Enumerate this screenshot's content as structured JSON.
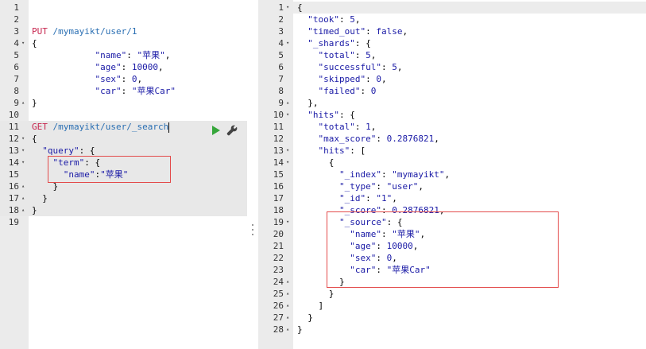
{
  "left_editor": {
    "lines": [
      {
        "n": "1",
        "fold": "",
        "segments": []
      },
      {
        "n": "2",
        "fold": "",
        "segments": []
      },
      {
        "n": "3",
        "fold": "",
        "segments": [
          {
            "t": "PUT",
            "c": "kw"
          },
          {
            "t": " ",
            "c": "punc"
          },
          {
            "t": "/mymayikt/user/1",
            "c": "url"
          }
        ]
      },
      {
        "n": "4",
        "fold": "▾",
        "segments": [
          {
            "t": "{",
            "c": "punc"
          }
        ]
      },
      {
        "n": "5",
        "fold": "",
        "indent": "            ",
        "segments": [
          {
            "t": "\"name\"",
            "c": "key"
          },
          {
            "t": ": ",
            "c": "punc"
          },
          {
            "t": "\"苹果\"",
            "c": "str"
          },
          {
            "t": ",",
            "c": "punc"
          }
        ]
      },
      {
        "n": "6",
        "fold": "",
        "indent": "            ",
        "segments": [
          {
            "t": "\"age\"",
            "c": "key"
          },
          {
            "t": ": ",
            "c": "punc"
          },
          {
            "t": "10000",
            "c": "num"
          },
          {
            "t": ",",
            "c": "punc"
          }
        ]
      },
      {
        "n": "7",
        "fold": "",
        "indent": "            ",
        "segments": [
          {
            "t": "\"sex\"",
            "c": "key"
          },
          {
            "t": ": ",
            "c": "punc"
          },
          {
            "t": "0",
            "c": "num"
          },
          {
            "t": ",",
            "c": "punc"
          }
        ]
      },
      {
        "n": "8",
        "fold": "",
        "indent": "            ",
        "segments": [
          {
            "t": "\"car\"",
            "c": "key"
          },
          {
            "t": ": ",
            "c": "punc"
          },
          {
            "t": "\"苹果Car\"",
            "c": "str"
          }
        ]
      },
      {
        "n": "9",
        "fold": "▴",
        "segments": [
          {
            "t": "}",
            "c": "punc"
          }
        ]
      },
      {
        "n": "10",
        "fold": "",
        "segments": []
      },
      {
        "n": "11",
        "fold": "",
        "segments": [
          {
            "t": "GET",
            "c": "kw"
          },
          {
            "t": " ",
            "c": "punc"
          },
          {
            "t": "/mymayikt/user/_search",
            "c": "url"
          }
        ]
      },
      {
        "n": "12",
        "fold": "▾",
        "segments": [
          {
            "t": "{",
            "c": "punc"
          }
        ]
      },
      {
        "n": "13",
        "fold": "▾",
        "indent": "  ",
        "segments": [
          {
            "t": "\"query\"",
            "c": "key"
          },
          {
            "t": ": {",
            "c": "punc"
          }
        ]
      },
      {
        "n": "14",
        "fold": "▾",
        "indent": "    ",
        "segments": [
          {
            "t": "\"term\"",
            "c": "key"
          },
          {
            "t": ": {",
            "c": "punc"
          }
        ]
      },
      {
        "n": "15",
        "fold": "",
        "indent": "      ",
        "segments": [
          {
            "t": "\"name\"",
            "c": "key"
          },
          {
            "t": ":",
            "c": "punc"
          },
          {
            "t": "\"苹果\"",
            "c": "str"
          }
        ]
      },
      {
        "n": "16",
        "fold": "▴",
        "indent": "    ",
        "segments": [
          {
            "t": "}",
            "c": "punc"
          }
        ]
      },
      {
        "n": "17",
        "fold": "▴",
        "indent": "  ",
        "segments": [
          {
            "t": "}",
            "c": "punc"
          }
        ]
      },
      {
        "n": "18",
        "fold": "▴",
        "segments": [
          {
            "t": "}",
            "c": "punc"
          }
        ]
      },
      {
        "n": "19",
        "fold": "",
        "segments": []
      }
    ]
  },
  "right_editor": {
    "lines": [
      {
        "n": "1",
        "fold": "▾",
        "segments": [
          {
            "t": "{",
            "c": "punc"
          }
        ]
      },
      {
        "n": "2",
        "fold": "",
        "indent": "  ",
        "segments": [
          {
            "t": "\"took\"",
            "c": "key"
          },
          {
            "t": ": ",
            "c": "punc"
          },
          {
            "t": "5",
            "c": "num"
          },
          {
            "t": ",",
            "c": "punc"
          }
        ]
      },
      {
        "n": "3",
        "fold": "",
        "indent": "  ",
        "segments": [
          {
            "t": "\"timed_out\"",
            "c": "key"
          },
          {
            "t": ": ",
            "c": "punc"
          },
          {
            "t": "false",
            "c": "bool"
          },
          {
            "t": ",",
            "c": "punc"
          }
        ]
      },
      {
        "n": "4",
        "fold": "▾",
        "indent": "  ",
        "segments": [
          {
            "t": "\"_shards\"",
            "c": "key"
          },
          {
            "t": ": {",
            "c": "punc"
          }
        ]
      },
      {
        "n": "5",
        "fold": "",
        "indent": "    ",
        "segments": [
          {
            "t": "\"total\"",
            "c": "key"
          },
          {
            "t": ": ",
            "c": "punc"
          },
          {
            "t": "5",
            "c": "num"
          },
          {
            "t": ",",
            "c": "punc"
          }
        ]
      },
      {
        "n": "6",
        "fold": "",
        "indent": "    ",
        "segments": [
          {
            "t": "\"successful\"",
            "c": "key"
          },
          {
            "t": ": ",
            "c": "punc"
          },
          {
            "t": "5",
            "c": "num"
          },
          {
            "t": ",",
            "c": "punc"
          }
        ]
      },
      {
        "n": "7",
        "fold": "",
        "indent": "    ",
        "segments": [
          {
            "t": "\"skipped\"",
            "c": "key"
          },
          {
            "t": ": ",
            "c": "punc"
          },
          {
            "t": "0",
            "c": "num"
          },
          {
            "t": ",",
            "c": "punc"
          }
        ]
      },
      {
        "n": "8",
        "fold": "",
        "indent": "    ",
        "segments": [
          {
            "t": "\"failed\"",
            "c": "key"
          },
          {
            "t": ": ",
            "c": "punc"
          },
          {
            "t": "0",
            "c": "num"
          }
        ]
      },
      {
        "n": "9",
        "fold": "▴",
        "indent": "  ",
        "segments": [
          {
            "t": "},",
            "c": "punc"
          }
        ]
      },
      {
        "n": "10",
        "fold": "▾",
        "indent": "  ",
        "segments": [
          {
            "t": "\"hits\"",
            "c": "key"
          },
          {
            "t": ": {",
            "c": "punc"
          }
        ]
      },
      {
        "n": "11",
        "fold": "",
        "indent": "    ",
        "segments": [
          {
            "t": "\"total\"",
            "c": "key"
          },
          {
            "t": ": ",
            "c": "punc"
          },
          {
            "t": "1",
            "c": "num"
          },
          {
            "t": ",",
            "c": "punc"
          }
        ]
      },
      {
        "n": "12",
        "fold": "",
        "indent": "    ",
        "segments": [
          {
            "t": "\"max_score\"",
            "c": "key"
          },
          {
            "t": ": ",
            "c": "punc"
          },
          {
            "t": "0.2876821",
            "c": "num"
          },
          {
            "t": ",",
            "c": "punc"
          }
        ]
      },
      {
        "n": "13",
        "fold": "▾",
        "indent": "    ",
        "segments": [
          {
            "t": "\"hits\"",
            "c": "key"
          },
          {
            "t": ": [",
            "c": "punc"
          }
        ]
      },
      {
        "n": "14",
        "fold": "▾",
        "indent": "      ",
        "segments": [
          {
            "t": "{",
            "c": "punc"
          }
        ]
      },
      {
        "n": "15",
        "fold": "",
        "indent": "        ",
        "segments": [
          {
            "t": "\"_index\"",
            "c": "key"
          },
          {
            "t": ": ",
            "c": "punc"
          },
          {
            "t": "\"mymayikt\"",
            "c": "str"
          },
          {
            "t": ",",
            "c": "punc"
          }
        ]
      },
      {
        "n": "16",
        "fold": "",
        "indent": "        ",
        "segments": [
          {
            "t": "\"_type\"",
            "c": "key"
          },
          {
            "t": ": ",
            "c": "punc"
          },
          {
            "t": "\"user\"",
            "c": "str"
          },
          {
            "t": ",",
            "c": "punc"
          }
        ]
      },
      {
        "n": "17",
        "fold": "",
        "indent": "        ",
        "segments": [
          {
            "t": "\"_id\"",
            "c": "key"
          },
          {
            "t": ": ",
            "c": "punc"
          },
          {
            "t": "\"1\"",
            "c": "str"
          },
          {
            "t": ",",
            "c": "punc"
          }
        ]
      },
      {
        "n": "18",
        "fold": "",
        "indent": "        ",
        "segments": [
          {
            "t": "\"_score\"",
            "c": "key"
          },
          {
            "t": ": ",
            "c": "punc"
          },
          {
            "t": "0.2876821",
            "c": "num"
          },
          {
            "t": ",",
            "c": "punc"
          }
        ]
      },
      {
        "n": "19",
        "fold": "▾",
        "indent": "        ",
        "segments": [
          {
            "t": "\"_source\"",
            "c": "key"
          },
          {
            "t": ": {",
            "c": "punc"
          }
        ]
      },
      {
        "n": "20",
        "fold": "",
        "indent": "          ",
        "segments": [
          {
            "t": "\"name\"",
            "c": "key"
          },
          {
            "t": ": ",
            "c": "punc"
          },
          {
            "t": "\"苹果\"",
            "c": "str"
          },
          {
            "t": ",",
            "c": "punc"
          }
        ]
      },
      {
        "n": "21",
        "fold": "",
        "indent": "          ",
        "segments": [
          {
            "t": "\"age\"",
            "c": "key"
          },
          {
            "t": ": ",
            "c": "punc"
          },
          {
            "t": "10000",
            "c": "num"
          },
          {
            "t": ",",
            "c": "punc"
          }
        ]
      },
      {
        "n": "22",
        "fold": "",
        "indent": "          ",
        "segments": [
          {
            "t": "\"sex\"",
            "c": "key"
          },
          {
            "t": ": ",
            "c": "punc"
          },
          {
            "t": "0",
            "c": "num"
          },
          {
            "t": ",",
            "c": "punc"
          }
        ]
      },
      {
        "n": "23",
        "fold": "",
        "indent": "          ",
        "segments": [
          {
            "t": "\"car\"",
            "c": "key"
          },
          {
            "t": ": ",
            "c": "punc"
          },
          {
            "t": "\"苹果Car\"",
            "c": "str"
          }
        ]
      },
      {
        "n": "24",
        "fold": "▴",
        "indent": "        ",
        "segments": [
          {
            "t": "}",
            "c": "punc"
          }
        ]
      },
      {
        "n": "25",
        "fold": "▴",
        "indent": "      ",
        "segments": [
          {
            "t": "}",
            "c": "punc"
          }
        ]
      },
      {
        "n": "26",
        "fold": "▴",
        "indent": "    ",
        "segments": [
          {
            "t": "]",
            "c": "punc"
          }
        ]
      },
      {
        "n": "27",
        "fold": "▴",
        "indent": "  ",
        "segments": [
          {
            "t": "}",
            "c": "punc"
          }
        ]
      },
      {
        "n": "28",
        "fold": "▴",
        "segments": [
          {
            "t": "}",
            "c": "punc"
          }
        ]
      }
    ]
  },
  "actions": {
    "run_icon": "play-icon",
    "settings_icon": "wrench-icon"
  },
  "colors": {
    "method": "#c7254e",
    "url": "#2a6fb3",
    "json_value": "#1a1aa6",
    "run_button": "#36a63b",
    "annotation_box": "#e34b4b"
  }
}
